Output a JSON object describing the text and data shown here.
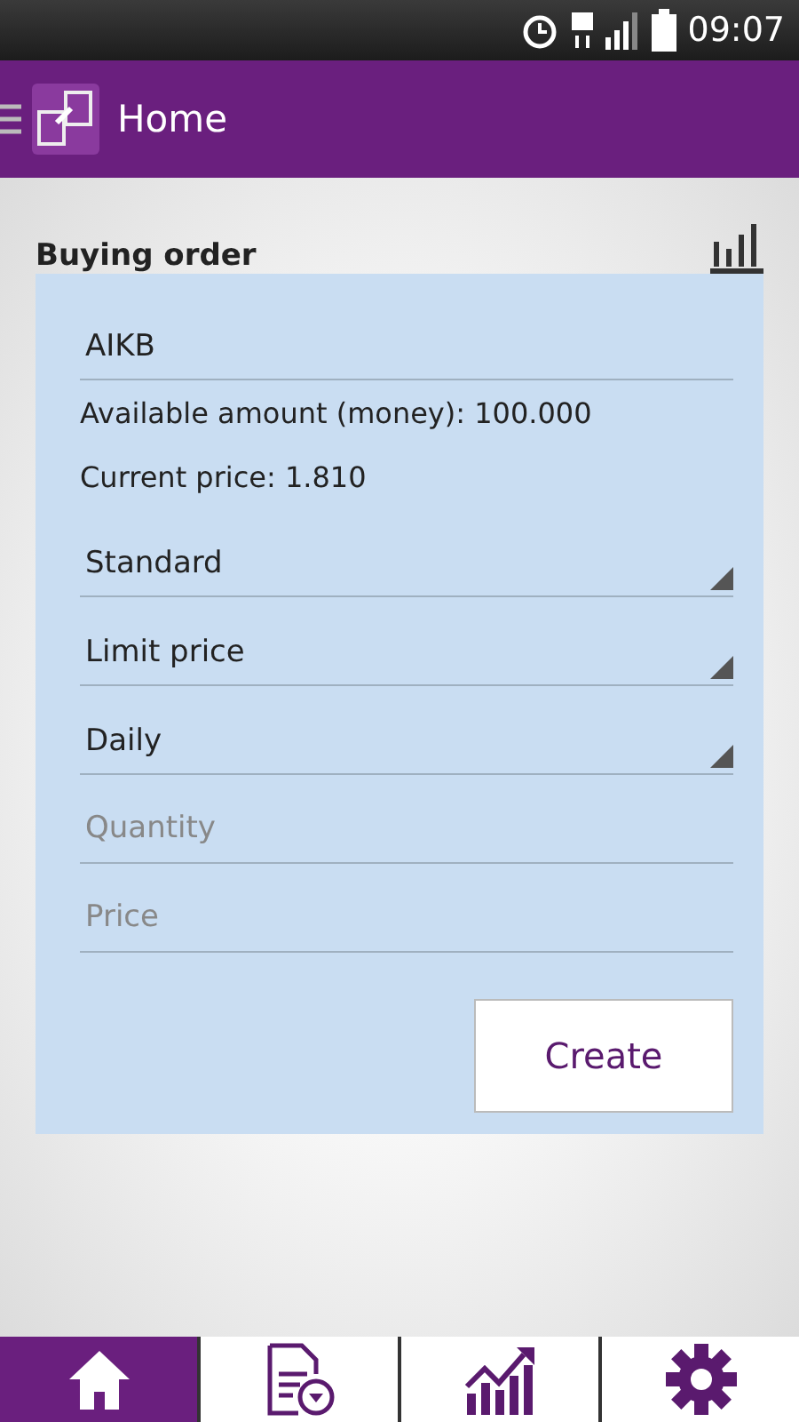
{
  "status_bar": {
    "time": "09:07"
  },
  "app_bar": {
    "title": "Home"
  },
  "section": {
    "title": "Buying order"
  },
  "form": {
    "items": [
      {
        "kind": "value",
        "text": "AIKB"
      },
      {
        "kind": "info",
        "text": "Available amount (money): 100.000"
      },
      {
        "kind": "info",
        "text": "Current price: 1.810"
      },
      {
        "kind": "dropdown",
        "text": "Standard"
      },
      {
        "kind": "dropdown",
        "text": "Limit price"
      },
      {
        "kind": "dropdown",
        "text": "Daily"
      },
      {
        "kind": "input",
        "placeholder": "Quantity"
      },
      {
        "kind": "input",
        "placeholder": "Price"
      }
    ],
    "button": "Create"
  },
  "bottom_nav": [
    {
      "kind": "home",
      "selected": true
    },
    {
      "kind": "orders",
      "selected": false
    },
    {
      "kind": "chart",
      "selected": false
    },
    {
      "kind": "settings",
      "selected": false
    }
  ]
}
